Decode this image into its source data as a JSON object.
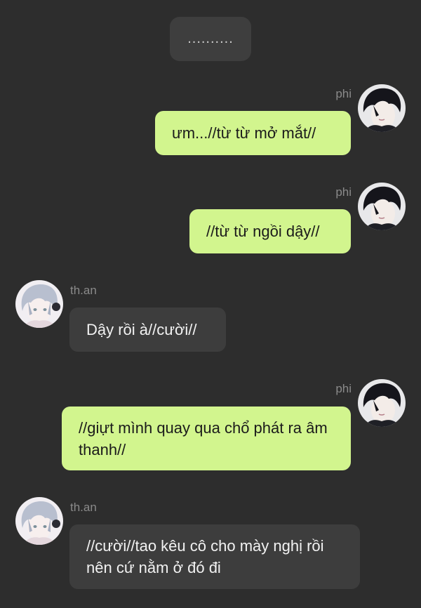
{
  "top_pill": "..........",
  "messages": [
    {
      "sender": "phi",
      "text": "ưm...//từ từ mở mắt//"
    },
    {
      "sender": "phi",
      "text": "//từ từ ngồi dậy//"
    },
    {
      "sender": "th.an",
      "text": "Dậy rồi à//cười//"
    },
    {
      "sender": "phi",
      "text": "//giựt mình quay qua chổ phát ra âm thanh//"
    },
    {
      "sender": "th.an",
      "text": "//cười//tao kêu cô cho mày nghị rồi nên cứ nằm ở đó đi"
    }
  ],
  "colors": {
    "background": "#2d2d2d",
    "my_bubble": "#d2f58e",
    "their_bubble": "#3d3d3d",
    "name_text": "#8a8a8a"
  },
  "icons": {
    "phi_avatar": "avatar-dark-hair-boy",
    "than_avatar": "avatar-silver-hair-boy"
  }
}
